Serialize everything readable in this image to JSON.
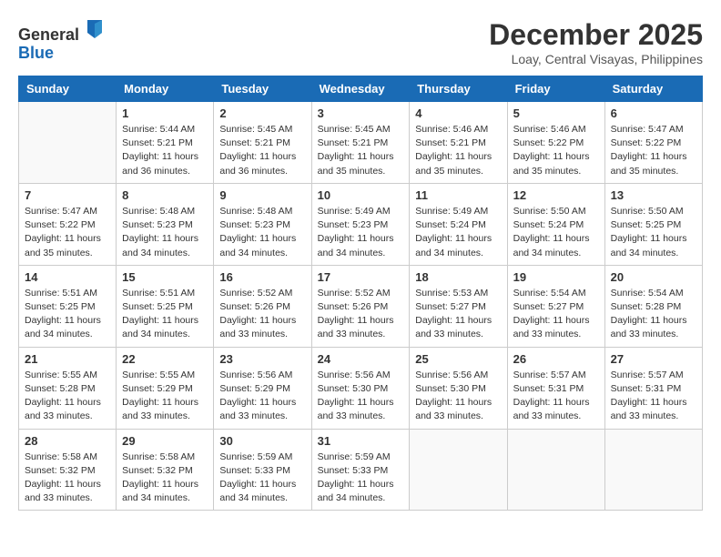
{
  "header": {
    "logo_line1": "General",
    "logo_line2": "Blue",
    "month_title": "December 2025",
    "location": "Loay, Central Visayas, Philippines"
  },
  "weekdays": [
    "Sunday",
    "Monday",
    "Tuesday",
    "Wednesday",
    "Thursday",
    "Friday",
    "Saturday"
  ],
  "weeks": [
    [
      {
        "day": "",
        "info": ""
      },
      {
        "day": "1",
        "info": "Sunrise: 5:44 AM\nSunset: 5:21 PM\nDaylight: 11 hours\nand 36 minutes."
      },
      {
        "day": "2",
        "info": "Sunrise: 5:45 AM\nSunset: 5:21 PM\nDaylight: 11 hours\nand 36 minutes."
      },
      {
        "day": "3",
        "info": "Sunrise: 5:45 AM\nSunset: 5:21 PM\nDaylight: 11 hours\nand 35 minutes."
      },
      {
        "day": "4",
        "info": "Sunrise: 5:46 AM\nSunset: 5:21 PM\nDaylight: 11 hours\nand 35 minutes."
      },
      {
        "day": "5",
        "info": "Sunrise: 5:46 AM\nSunset: 5:22 PM\nDaylight: 11 hours\nand 35 minutes."
      },
      {
        "day": "6",
        "info": "Sunrise: 5:47 AM\nSunset: 5:22 PM\nDaylight: 11 hours\nand 35 minutes."
      }
    ],
    [
      {
        "day": "7",
        "info": "Sunrise: 5:47 AM\nSunset: 5:22 PM\nDaylight: 11 hours\nand 35 minutes."
      },
      {
        "day": "8",
        "info": "Sunrise: 5:48 AM\nSunset: 5:23 PM\nDaylight: 11 hours\nand 34 minutes."
      },
      {
        "day": "9",
        "info": "Sunrise: 5:48 AM\nSunset: 5:23 PM\nDaylight: 11 hours\nand 34 minutes."
      },
      {
        "day": "10",
        "info": "Sunrise: 5:49 AM\nSunset: 5:23 PM\nDaylight: 11 hours\nand 34 minutes."
      },
      {
        "day": "11",
        "info": "Sunrise: 5:49 AM\nSunset: 5:24 PM\nDaylight: 11 hours\nand 34 minutes."
      },
      {
        "day": "12",
        "info": "Sunrise: 5:50 AM\nSunset: 5:24 PM\nDaylight: 11 hours\nand 34 minutes."
      },
      {
        "day": "13",
        "info": "Sunrise: 5:50 AM\nSunset: 5:25 PM\nDaylight: 11 hours\nand 34 minutes."
      }
    ],
    [
      {
        "day": "14",
        "info": "Sunrise: 5:51 AM\nSunset: 5:25 PM\nDaylight: 11 hours\nand 34 minutes."
      },
      {
        "day": "15",
        "info": "Sunrise: 5:51 AM\nSunset: 5:25 PM\nDaylight: 11 hours\nand 34 minutes."
      },
      {
        "day": "16",
        "info": "Sunrise: 5:52 AM\nSunset: 5:26 PM\nDaylight: 11 hours\nand 33 minutes."
      },
      {
        "day": "17",
        "info": "Sunrise: 5:52 AM\nSunset: 5:26 PM\nDaylight: 11 hours\nand 33 minutes."
      },
      {
        "day": "18",
        "info": "Sunrise: 5:53 AM\nSunset: 5:27 PM\nDaylight: 11 hours\nand 33 minutes."
      },
      {
        "day": "19",
        "info": "Sunrise: 5:54 AM\nSunset: 5:27 PM\nDaylight: 11 hours\nand 33 minutes."
      },
      {
        "day": "20",
        "info": "Sunrise: 5:54 AM\nSunset: 5:28 PM\nDaylight: 11 hours\nand 33 minutes."
      }
    ],
    [
      {
        "day": "21",
        "info": "Sunrise: 5:55 AM\nSunset: 5:28 PM\nDaylight: 11 hours\nand 33 minutes."
      },
      {
        "day": "22",
        "info": "Sunrise: 5:55 AM\nSunset: 5:29 PM\nDaylight: 11 hours\nand 33 minutes."
      },
      {
        "day": "23",
        "info": "Sunrise: 5:56 AM\nSunset: 5:29 PM\nDaylight: 11 hours\nand 33 minutes."
      },
      {
        "day": "24",
        "info": "Sunrise: 5:56 AM\nSunset: 5:30 PM\nDaylight: 11 hours\nand 33 minutes."
      },
      {
        "day": "25",
        "info": "Sunrise: 5:56 AM\nSunset: 5:30 PM\nDaylight: 11 hours\nand 33 minutes."
      },
      {
        "day": "26",
        "info": "Sunrise: 5:57 AM\nSunset: 5:31 PM\nDaylight: 11 hours\nand 33 minutes."
      },
      {
        "day": "27",
        "info": "Sunrise: 5:57 AM\nSunset: 5:31 PM\nDaylight: 11 hours\nand 33 minutes."
      }
    ],
    [
      {
        "day": "28",
        "info": "Sunrise: 5:58 AM\nSunset: 5:32 PM\nDaylight: 11 hours\nand 33 minutes."
      },
      {
        "day": "29",
        "info": "Sunrise: 5:58 AM\nSunset: 5:32 PM\nDaylight: 11 hours\nand 34 minutes."
      },
      {
        "day": "30",
        "info": "Sunrise: 5:59 AM\nSunset: 5:33 PM\nDaylight: 11 hours\nand 34 minutes."
      },
      {
        "day": "31",
        "info": "Sunrise: 5:59 AM\nSunset: 5:33 PM\nDaylight: 11 hours\nand 34 minutes."
      },
      {
        "day": "",
        "info": ""
      },
      {
        "day": "",
        "info": ""
      },
      {
        "day": "",
        "info": ""
      }
    ]
  ]
}
